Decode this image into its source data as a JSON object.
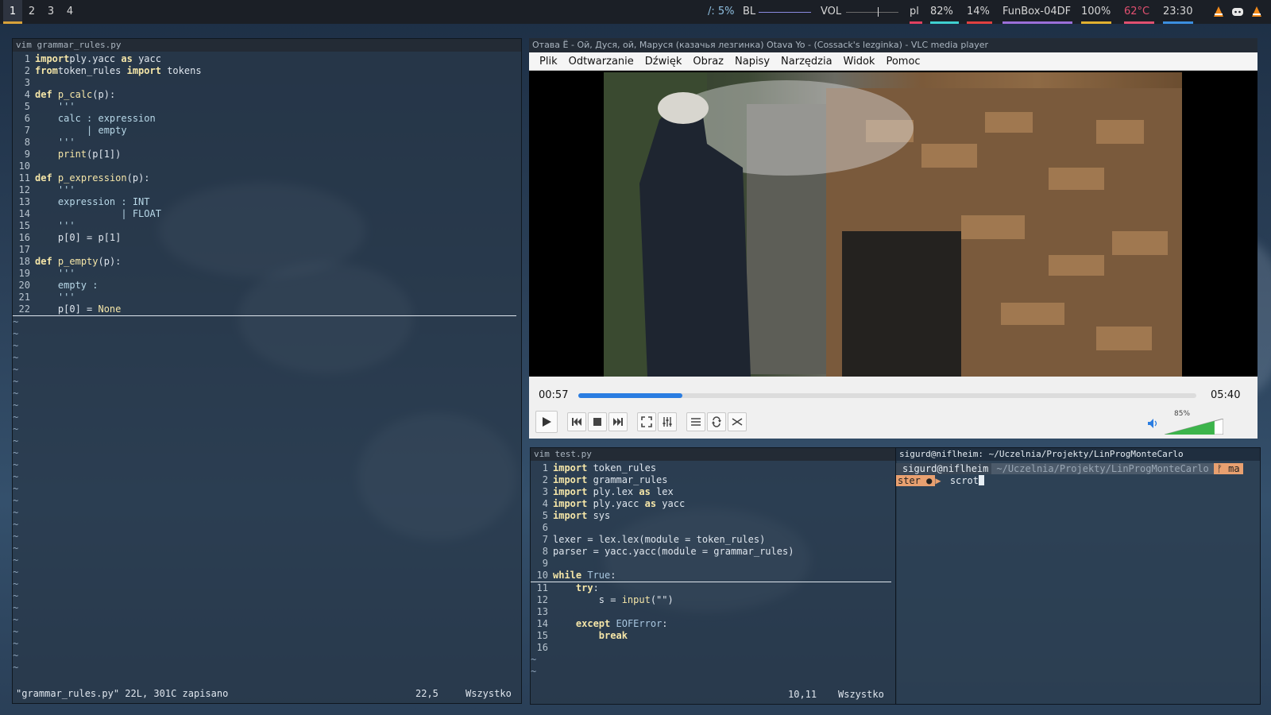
{
  "topbar": {
    "workspaces": [
      "1",
      "2",
      "3",
      "4"
    ],
    "active_workspace": "1",
    "cpu": "/: 5%",
    "bl_label": "BL",
    "vol_label": "VOL",
    "lang": "pl",
    "battery": "82%",
    "disk": "14%",
    "network": "FunBox-04DF",
    "brightness": "100%",
    "temp": "62°C",
    "clock": "23:30",
    "tray_icons": [
      "vlc-icon",
      "discord-icon",
      "vlc-icon"
    ],
    "colors": {
      "temp": "#e05070",
      "battery_ul": "#3fd0d0",
      "disk_ul": "#e04040",
      "net_ul": "#9b6fd9",
      "bright_ul": "#e0b030",
      "temp_ul": "#e05070",
      "clock_ul": "#3c8fe0",
      "lang_ul": "#e04060"
    }
  },
  "vim_left": {
    "title": "vim grammar_rules.py",
    "lines": [
      {
        "n": "1",
        "segs": [
          [
            "kw",
            "import"
          ],
          [
            "",
            "ply.yacc "
          ],
          [
            "kw",
            "as"
          ],
          [
            "",
            " yacc"
          ]
        ]
      },
      {
        "n": "2",
        "segs": [
          [
            "kw",
            "from"
          ],
          [
            "",
            "token_rules "
          ],
          [
            "kw",
            "import"
          ],
          [
            "",
            " tokens"
          ]
        ]
      },
      {
        "n": "3",
        "segs": []
      },
      {
        "n": "4",
        "segs": [
          [
            "kw",
            "def"
          ],
          [
            "",
            " "
          ],
          [
            "fn",
            "p_calc"
          ],
          [
            "",
            "(p):"
          ]
        ]
      },
      {
        "n": "5",
        "segs": [
          [
            "cm",
            "    '''"
          ]
        ]
      },
      {
        "n": "6",
        "segs": [
          [
            "cm",
            "    calc : expression"
          ]
        ]
      },
      {
        "n": "7",
        "segs": [
          [
            "cm",
            "         | empty"
          ]
        ]
      },
      {
        "n": "8",
        "segs": [
          [
            "cm",
            "    '''"
          ]
        ]
      },
      {
        "n": "9",
        "segs": [
          [
            "",
            "    "
          ],
          [
            "fn",
            "print"
          ],
          [
            "",
            "(p[1])"
          ]
        ]
      },
      {
        "n": "10",
        "segs": []
      },
      {
        "n": "11",
        "segs": [
          [
            "kw",
            "def"
          ],
          [
            "",
            " "
          ],
          [
            "fn",
            "p_expression"
          ],
          [
            "",
            "(p):"
          ]
        ]
      },
      {
        "n": "12",
        "segs": [
          [
            "cm",
            "    '''"
          ]
        ]
      },
      {
        "n": "13",
        "segs": [
          [
            "cm",
            "    expression : INT"
          ]
        ]
      },
      {
        "n": "14",
        "segs": [
          [
            "cm",
            "               | FLOAT"
          ]
        ]
      },
      {
        "n": "15",
        "segs": [
          [
            "cm",
            "    '''"
          ]
        ]
      },
      {
        "n": "16",
        "segs": [
          [
            "",
            "    p[0] = p[1]"
          ]
        ]
      },
      {
        "n": "17",
        "segs": []
      },
      {
        "n": "18",
        "segs": [
          [
            "kw",
            "def"
          ],
          [
            "",
            " "
          ],
          [
            "fn",
            "p_empty"
          ],
          [
            "",
            "(p):"
          ]
        ]
      },
      {
        "n": "19",
        "segs": [
          [
            "cm",
            "    '''"
          ]
        ]
      },
      {
        "n": "20",
        "segs": [
          [
            "cm",
            "    empty :"
          ]
        ]
      },
      {
        "n": "21",
        "segs": [
          [
            "cm",
            "    '''"
          ]
        ]
      },
      {
        "n": "22",
        "segs": [
          [
            "",
            "    p[0] = "
          ],
          [
            "fn",
            "None"
          ]
        ]
      }
    ],
    "tilde": "~",
    "status_msg": "\"grammar_rules.py\" 22L, 301C zapisano",
    "status_pos": "22,5",
    "status_all": "Wszystko"
  },
  "vlc": {
    "title": "Отава Ё - Ой, Дуся, ой, Маруся (казачья лезгинка) Otava Yo - (Cossack's lezginka) - VLC media player",
    "menu": [
      "Plik",
      "Odtwarzanie",
      "Dźwięk",
      "Obraz",
      "Napisy",
      "Narzędzia",
      "Widok",
      "Pomoc"
    ],
    "elapsed": "00:57",
    "duration": "05:40",
    "progress": 0.168,
    "volume_label": "85%",
    "volume": 0.85
  },
  "vim_right": {
    "title": "vim test.py",
    "lines": [
      {
        "n": "1",
        "segs": [
          [
            "kw",
            "import"
          ],
          [
            "",
            " token_rules"
          ]
        ]
      },
      {
        "n": "2",
        "segs": [
          [
            "kw",
            "import"
          ],
          [
            "",
            " grammar_rules"
          ]
        ]
      },
      {
        "n": "3",
        "segs": [
          [
            "kw",
            "import"
          ],
          [
            "",
            " ply.lex "
          ],
          [
            "kw",
            "as"
          ],
          [
            "",
            " lex"
          ]
        ]
      },
      {
        "n": "4",
        "segs": [
          [
            "kw",
            "import"
          ],
          [
            "",
            " ply.yacc "
          ],
          [
            "kw",
            "as"
          ],
          [
            "",
            " yacc"
          ]
        ]
      },
      {
        "n": "5",
        "segs": [
          [
            "kw",
            "import"
          ],
          [
            "",
            " sys"
          ]
        ]
      },
      {
        "n": "6",
        "segs": []
      },
      {
        "n": "7",
        "segs": [
          [
            "",
            "lexer = lex.lex(module = token_rules)"
          ]
        ]
      },
      {
        "n": "8",
        "segs": [
          [
            "",
            "parser = yacc.yacc(module = grammar_rules)"
          ]
        ]
      },
      {
        "n": "9",
        "segs": []
      },
      {
        "n": "10",
        "segs": [
          [
            "kw",
            "while"
          ],
          [
            "",
            " "
          ],
          [
            "str",
            "True"
          ],
          [
            "",
            ":"
          ]
        ]
      },
      {
        "n": "11",
        "segs": [
          [
            "",
            "    "
          ],
          [
            "kw",
            "try"
          ],
          [
            "",
            ":"
          ]
        ]
      },
      {
        "n": "12",
        "segs": [
          [
            "",
            "        s = "
          ],
          [
            "fn",
            "input"
          ],
          [
            "",
            "(\"\")"
          ]
        ]
      },
      {
        "n": "13",
        "segs": []
      },
      {
        "n": "14",
        "segs": [
          [
            "",
            "    "
          ],
          [
            "kw",
            "except"
          ],
          [
            "",
            " "
          ],
          [
            "str",
            "EOFError"
          ],
          [
            "",
            ":"
          ]
        ]
      },
      {
        "n": "15",
        "segs": [
          [
            "",
            "        "
          ],
          [
            "kw",
            "break"
          ]
        ]
      },
      {
        "n": "16",
        "segs": []
      }
    ],
    "tilde": "~",
    "status_pos": "10,11",
    "status_all": "Wszystko"
  },
  "terminal": {
    "title": "sigurd@niflheim: ~/Uczelnia/Projekty/LinProgMonteCarlo",
    "user_host": "sigurd@niflheim",
    "path": "~/Uczelnia/Projekty/LinProgMonteCarlo",
    "branch_a": "ᚠ ma",
    "branch_b": "ster ●",
    "command": "scrot"
  }
}
